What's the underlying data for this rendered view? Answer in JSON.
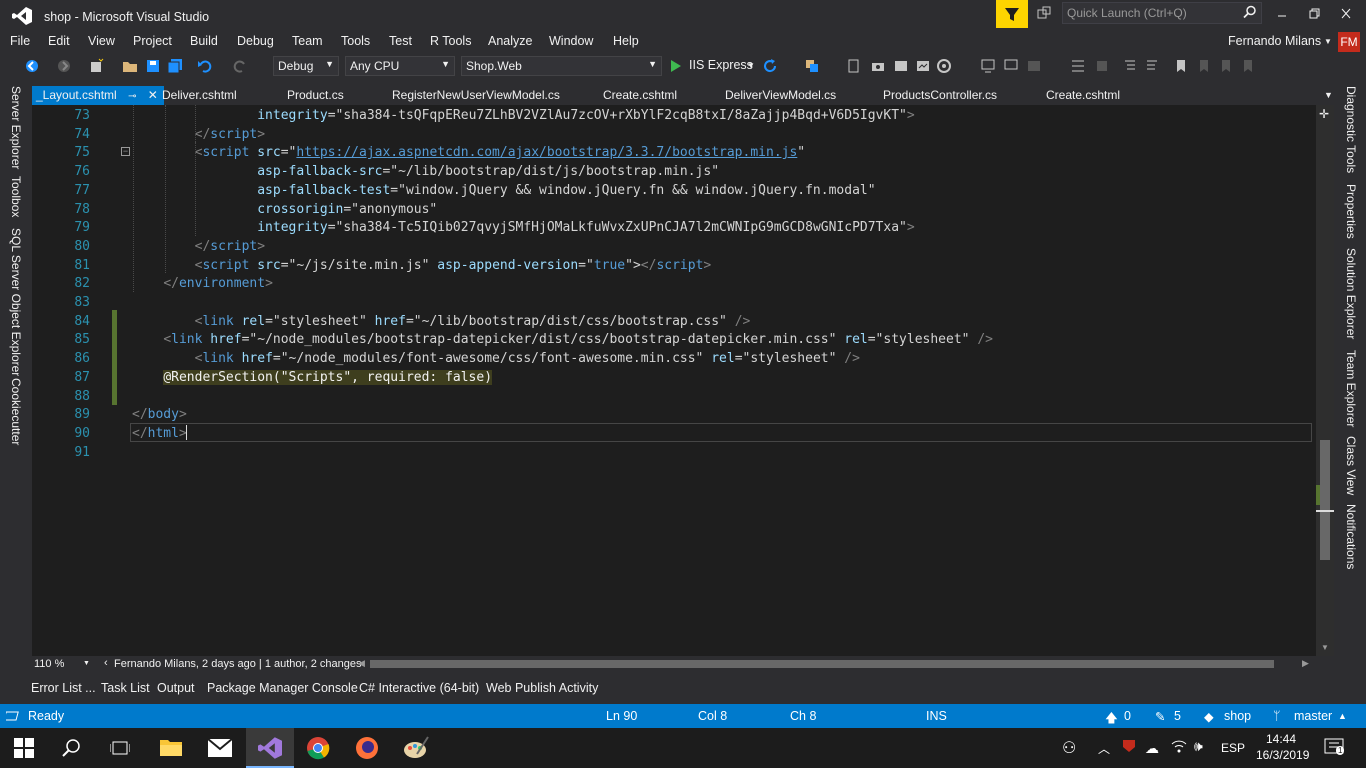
{
  "window": {
    "title": "shop - Microsoft Visual Studio",
    "quick_launch_placeholder": "Quick Launch (Ctrl+Q)"
  },
  "menu": {
    "items": [
      "File",
      "Edit",
      "View",
      "Project",
      "Build",
      "Debug",
      "Team",
      "Tools",
      "Test",
      "R Tools",
      "Analyze",
      "Window",
      "Help"
    ],
    "user": "Fernando Milans",
    "user_initials": "FM"
  },
  "toolbar": {
    "config": "Debug",
    "platform": "Any CPU",
    "startup_project": "Shop.Web",
    "run_label": "IIS Express"
  },
  "tabs": [
    {
      "label": "_Layout.cshtml",
      "active": true
    },
    {
      "label": "Deliver.cshtml"
    },
    {
      "label": "Product.cs"
    },
    {
      "label": "RegisterNewUserViewModel.cs"
    },
    {
      "label": "Create.cshtml"
    },
    {
      "label": "DeliverViewModel.cs"
    },
    {
      "label": "ProductsController.cs"
    },
    {
      "label": "Create.cshtml"
    }
  ],
  "left_rail": [
    "Server Explorer",
    "Toolbox",
    "SQL Server Object Explorer",
    "Cookiecutter"
  ],
  "right_rail": [
    "Diagnostic Tools",
    "Properties",
    "Solution Explorer",
    "Team Explorer",
    "Class View",
    "Notifications"
  ],
  "code": {
    "lines": [
      {
        "n": "73",
        "parts": [
          [
            "sp",
            "                "
          ],
          [
            "attr",
            "integrity"
          ],
          [
            "val",
            "="
          ],
          [
            "val",
            "\"sha384-tsQFqpEReu7ZLhBV2VZlAu7zcOV+rXbYlF2cqB8txI/8aZajjp4Bqd+V6D5IgvKT\""
          ],
          [
            "bracket",
            ">"
          ]
        ]
      },
      {
        "n": "74",
        "parts": [
          [
            "sp",
            "        "
          ],
          [
            "bracket",
            "</"
          ],
          [
            "tag",
            "script"
          ],
          [
            "bracket",
            ">"
          ]
        ]
      },
      {
        "n": "75",
        "parts": [
          [
            "sp",
            "        "
          ],
          [
            "bracket",
            "<"
          ],
          [
            "tag",
            "script "
          ],
          [
            "attr",
            "src"
          ],
          [
            "val",
            "=\""
          ],
          [
            "link",
            "https://ajax.aspnetcdn.com/ajax/bootstrap/3.3.7/bootstrap.min.js"
          ],
          [
            "val",
            "\""
          ]
        ]
      },
      {
        "n": "76",
        "parts": [
          [
            "sp",
            "                "
          ],
          [
            "attr",
            "asp-fallback-src"
          ],
          [
            "val",
            "=\"~/lib/bootstrap/dist/js/bootstrap.min.js\""
          ]
        ]
      },
      {
        "n": "77",
        "parts": [
          [
            "sp",
            "                "
          ],
          [
            "attr",
            "asp-fallback-test"
          ],
          [
            "val",
            "=\"window.jQuery && window.jQuery.fn && window.jQuery.fn.modal\""
          ]
        ]
      },
      {
        "n": "78",
        "parts": [
          [
            "sp",
            "                "
          ],
          [
            "attr",
            "crossorigin"
          ],
          [
            "val",
            "=\"anonymous\""
          ]
        ]
      },
      {
        "n": "79",
        "parts": [
          [
            "sp",
            "                "
          ],
          [
            "attr",
            "integrity"
          ],
          [
            "val",
            "=\"sha384-Tc5IQib027qvyjSMfHjOMaLkfuWvxZxUPnCJA7l2mCWNIpG9mGCD8wGNIcPD7Txa\""
          ],
          [
            "bracket",
            ">"
          ]
        ]
      },
      {
        "n": "80",
        "parts": [
          [
            "sp",
            "        "
          ],
          [
            "bracket",
            "</"
          ],
          [
            "tag",
            "script"
          ],
          [
            "bracket",
            ">"
          ]
        ]
      },
      {
        "n": "81",
        "parts": [
          [
            "sp",
            "        "
          ],
          [
            "bracket",
            "<"
          ],
          [
            "tag",
            "script "
          ],
          [
            "attr",
            "src"
          ],
          [
            "val",
            "=\"~/js/site.min.js\" "
          ],
          [
            "attr",
            "asp-append-version"
          ],
          [
            "val",
            "=\""
          ],
          [
            "kw",
            "true"
          ],
          [
            "val",
            "\">"
          ],
          [
            "bracket",
            "</"
          ],
          [
            "tag",
            "script"
          ],
          [
            "bracket",
            ">"
          ]
        ]
      },
      {
        "n": "82",
        "parts": [
          [
            "sp",
            "    "
          ],
          [
            "bracket",
            "</"
          ],
          [
            "tag",
            "environment"
          ],
          [
            "bracket",
            ">"
          ]
        ]
      },
      {
        "n": "83",
        "parts": []
      },
      {
        "n": "84",
        "parts": [
          [
            "sp",
            "        "
          ],
          [
            "bracket",
            "<"
          ],
          [
            "tag",
            "link "
          ],
          [
            "attr",
            "rel"
          ],
          [
            "val",
            "=\"stylesheet\" "
          ],
          [
            "attr",
            "href"
          ],
          [
            "val",
            "=\"~/lib/bootstrap/dist/css/bootstrap.css\" "
          ],
          [
            "bracket",
            "/>"
          ]
        ]
      },
      {
        "n": "85",
        "parts": [
          [
            "sp",
            "    "
          ],
          [
            "bracket",
            "<"
          ],
          [
            "tag",
            "link "
          ],
          [
            "attr",
            "href"
          ],
          [
            "val",
            "=\"~/node_modules/bootstrap-datepicker/dist/css/bootstrap-datepicker.min.css\" "
          ],
          [
            "attr",
            "rel"
          ],
          [
            "val",
            "=\"stylesheet\" "
          ],
          [
            "bracket",
            "/>"
          ]
        ]
      },
      {
        "n": "86",
        "parts": [
          [
            "sp",
            "        "
          ],
          [
            "bracket",
            "<"
          ],
          [
            "tag",
            "link "
          ],
          [
            "attr",
            "href"
          ],
          [
            "val",
            "=\"~/node_modules/font-awesome/css/font-awesome.min.css\" "
          ],
          [
            "attr",
            "rel"
          ],
          [
            "val",
            "=\"stylesheet\" "
          ],
          [
            "bracket",
            "/>"
          ]
        ]
      },
      {
        "n": "87",
        "parts": [
          [
            "sp",
            "    "
          ],
          [
            "razor",
            "@RenderSection(\"Scripts\", required: false)"
          ]
        ]
      },
      {
        "n": "88",
        "parts": []
      },
      {
        "n": "89",
        "parts": [
          [
            "bracket",
            "</"
          ],
          [
            "tag",
            "body"
          ],
          [
            "bracket",
            ">"
          ]
        ]
      },
      {
        "n": "90",
        "parts": [
          [
            "bracket",
            "</"
          ],
          [
            "tag",
            "html"
          ],
          [
            "bracket",
            ">"
          ]
        ]
      },
      {
        "n": "91",
        "parts": []
      }
    ]
  },
  "editor_footer": {
    "zoom": "110 %",
    "blame": "Fernando Milans, 2 days ago | 1 author, 2 changes"
  },
  "bottom_tabs": [
    "Error List ...",
    "Task List",
    "Output",
    "Package Manager Console",
    "C# Interactive (64-bit)",
    "Web Publish Activity"
  ],
  "status": {
    "ready": "Ready",
    "ln": "Ln 90",
    "col": "Col 8",
    "ch": "Ch 8",
    "ins": "INS",
    "up": "0",
    "edits": "5",
    "repo": "shop",
    "branch": "master"
  },
  "taskbar": {
    "lang": "ESP",
    "time": "14:44",
    "date": "16/3/2019"
  },
  "colors": {
    "accent": "#007acc",
    "editor_bg": "#1e1e1e",
    "chrome_bg": "#2d2d30",
    "line_number": "#2b91af",
    "tag": "#569cd6",
    "attr": "#9cdcfe",
    "added_marker": "#577430"
  }
}
